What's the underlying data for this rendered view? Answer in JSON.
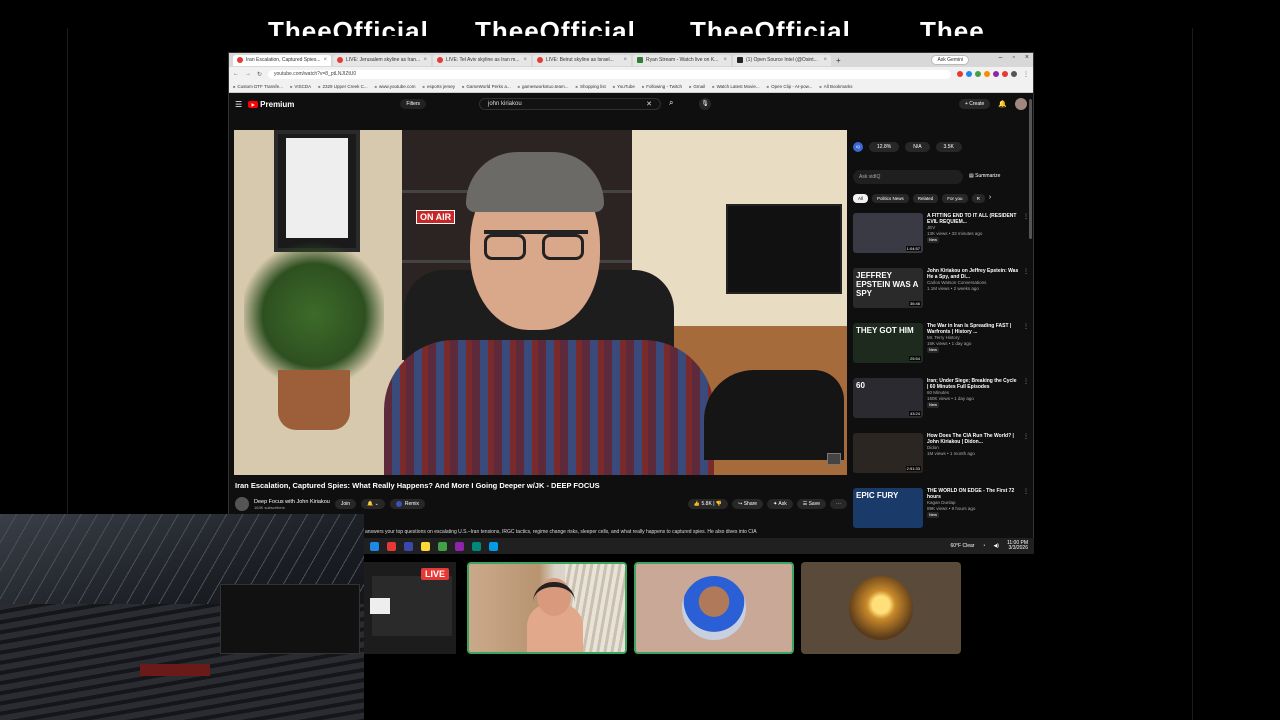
{
  "overlay": {
    "banner_segments": [
      "TheeOfficial",
      "TheeOfficial",
      "TheeOfficial",
      "Thee"
    ]
  },
  "browser": {
    "tabs": [
      {
        "label": "Iran Escalation, Captured Spies...",
        "icon": "youtube-icon",
        "active": true
      },
      {
        "label": "LIVE: Jerusalem skyline as Iran...",
        "icon": "youtube-icon",
        "active": false
      },
      {
        "label": "LIVE: Tel Aviv skyline as Iran m...",
        "icon": "youtube-icon",
        "active": false
      },
      {
        "label": "LIVE: Beirut skyline as Israel...",
        "icon": "youtube-icon",
        "active": false
      },
      {
        "label": "Ryan Stream - Watch live on K...",
        "icon": "kick-icon",
        "active": false
      },
      {
        "label": "(1) Open Source Intel (@Osint...",
        "icon": "x-icon",
        "active": false
      }
    ],
    "ask_gemini": "Ask Gemini",
    "url": "youtube.com/watch?v=8_ptLNJIZtU0",
    "bookmarks": [
      "Custom DTF Transfe...",
      "VISCDA",
      "2329 Upper Creek C...",
      "www.youtube.com",
      "esports jersey",
      "GameWorld Perks a...",
      "gamesworkstuo.team...",
      "Shopping list",
      "YouTube",
      "Following - Twitch",
      "Gmail",
      "Watch Latest Movie...",
      "Open Clip - AI-pow...",
      "All Bookmarks"
    ]
  },
  "youtube": {
    "logo": "Premium",
    "filters": "Filters",
    "search_query": "john kiriakou",
    "create": "Create",
    "video": {
      "on_air_sign": "ON AIR",
      "title": "Iran Escalation, Captured Spies: What Really Happens? And More I Going Deeper w/JK - DEEP FOCUS",
      "channel": "Deep Focus with John Kiriakou",
      "subscribers": "163K subscribers",
      "join": "Join",
      "remix": "Remix",
      "likes": "5.8K",
      "share": "Share",
      "ask": "Ask",
      "save": "Save",
      "description": "answers your top questions on escalating U.S.–Iran tensions, IRGC tactics, regime change risks, sleeper cells, and what really happens to captured spies. He also dives into CIA"
    },
    "extension_stats": [
      "12.8%",
      "N/A",
      "3.5K"
    ],
    "ask_placeholder": "Ask vidIQ",
    "summarize": "Summarize",
    "chips": [
      "All",
      "Politics News",
      "Related",
      "For you",
      "R"
    ],
    "recommendations": [
      {
        "title": "A FITTING END TO IT ALL (RESIDENT EVIL REQUIEM...",
        "channel": "JEV",
        "views": "13K views • 33 minutes ago",
        "badge": "New",
        "duration": "1:04:57",
        "thumb_color": "#3a3a44",
        "thumb_text": ""
      },
      {
        "title": "John Kiriakou on Jeffrey Epstein: Was He a Spy, and Di...",
        "channel": "Carlos Watson Conversations",
        "views": "1.1M views • 2 weeks ago",
        "badge": "",
        "duration": "36:46",
        "thumb_color": "#2a2a2a",
        "thumb_text": "JEFFREY EPSTEIN WAS A SPY"
      },
      {
        "title": "The War in Iran Is Spreading FAST | Warfronts | History ...",
        "channel": "Mr. Terry History",
        "views": "16K views • 1 day ago",
        "badge": "New",
        "duration": "25:54",
        "thumb_color": "#1f2a1f",
        "thumb_text": "THEY GOT HIM"
      },
      {
        "title": "Iran; Under Siege; Breaking the Cycle | 60 Minutes Full Episodes",
        "channel": "60 Minutes",
        "views": "150K views • 1 day ago",
        "badge": "New",
        "duration": "43:24",
        "thumb_color": "#2a2a30",
        "thumb_text": "60"
      },
      {
        "title": "How Does The CIA Run The World? | John Kiriakou | Didon...",
        "channel": "Didon",
        "views": "1M views • 1 month ago",
        "badge": "",
        "duration": "2:51:33",
        "thumb_color": "#2c2622",
        "thumb_text": ""
      },
      {
        "title": "THE WORLD ON EDGE - The First 72 hours",
        "channel": "Kagan Dunlap",
        "views": "89K views • 9 hours ago",
        "badge": "New",
        "duration": "",
        "thumb_color": "#1a3a6a",
        "thumb_text": "EPIC FURY"
      }
    ]
  },
  "taskbar": {
    "weather": "60°F Clear",
    "time": "11:00 PM",
    "date": "3/3/2026"
  },
  "stream": {
    "live_badge": "LIVE"
  }
}
